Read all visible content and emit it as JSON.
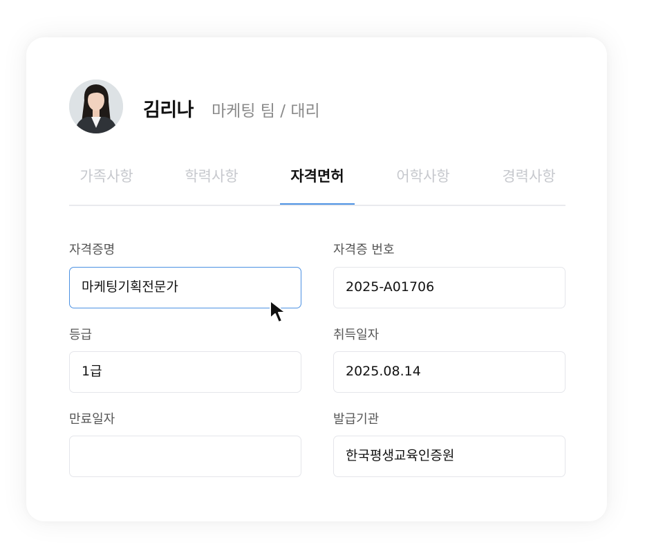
{
  "profile": {
    "name": "김리나",
    "department": "마케팅 팀 / 대리"
  },
  "tabs": [
    {
      "label": "가족사항",
      "active": false
    },
    {
      "label": "학력사항",
      "active": false
    },
    {
      "label": "자격면허",
      "active": true
    },
    {
      "label": "어학사항",
      "active": false
    },
    {
      "label": "경력사항",
      "active": false
    }
  ],
  "form": {
    "cert_name": {
      "label": "자격증명",
      "value": "마케팅기획전문가"
    },
    "cert_number": {
      "label": "자격증 번호",
      "value": "2025-A01706"
    },
    "grade": {
      "label": "등급",
      "value": "1급"
    },
    "acquired_date": {
      "label": "취득일자",
      "value": "2025.08.14"
    },
    "expiry_date": {
      "label": "만료일자",
      "value": ""
    },
    "issuer": {
      "label": "발급기관",
      "value": "한국평생교육인증원"
    }
  },
  "colors": {
    "accent": "#4a90e2",
    "field_border": "#e4e5ea",
    "tab_inactive": "#c6c8cd",
    "text_primary": "#111111",
    "text_secondary": "#8a8a8a"
  },
  "icons": {
    "cursor": "mouse-pointer-icon"
  }
}
